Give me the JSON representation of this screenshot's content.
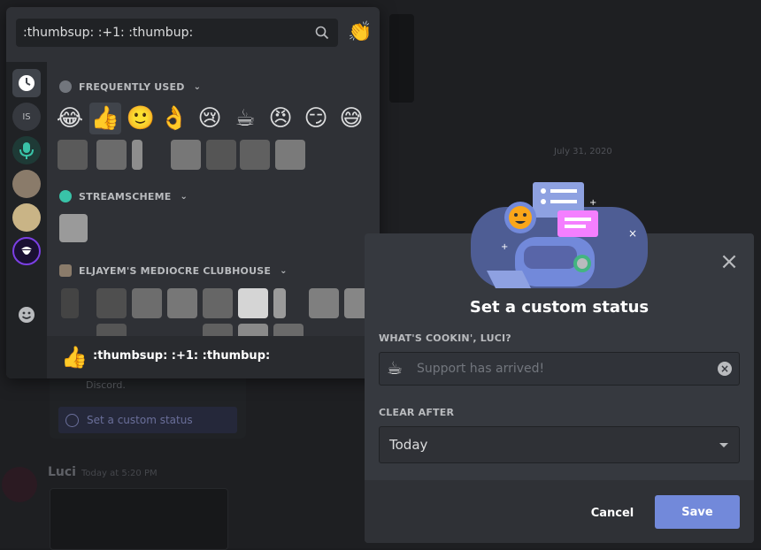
{
  "background": {
    "date_divider": "July 31, 2020",
    "card_text": "Discord.",
    "card_button": "Set a custom status",
    "username": "Luci",
    "timestamp": "Today at 5:20 PM"
  },
  "picker": {
    "search_value": ":thumbsup: :+1: :thumbup:",
    "header_emoji": "👏",
    "rail_items": [
      {
        "name": "frequently-used-icon",
        "glyph": "🕒"
      },
      {
        "name": "server-is",
        "glyph": "IS"
      },
      {
        "name": "server-streamscheme",
        "glyph": "🎙"
      },
      {
        "name": "server-1",
        "glyph": ""
      },
      {
        "name": "server-2",
        "glyph": ""
      },
      {
        "name": "server-3",
        "glyph": ""
      },
      {
        "name": "people-category-icon",
        "glyph": "☺"
      },
      {
        "name": "nature-category-icon",
        "glyph": "🍃"
      },
      {
        "name": "food-category-icon",
        "glyph": "🍦"
      }
    ],
    "categories": [
      {
        "label": "FREQUENTLY USED"
      },
      {
        "label": "STREAMSCHEME"
      },
      {
        "label": "ELJAYEM'S MEDIOCRE CLUBHOUSE"
      }
    ],
    "frequent_emojis": [
      "😂",
      "👍",
      "🙂",
      "👌",
      "😢",
      "☕",
      "😠",
      "😏",
      "😅"
    ],
    "footer_emoji": "👍",
    "footer_label": ":thumbsup: :+1: :thumbup:"
  },
  "modal": {
    "title": "Set a custom status",
    "status_label": "WHAT'S COOKIN', LUCI?",
    "status_emoji": "☕",
    "status_placeholder": "Support has arrived!",
    "clear_label": "CLEAR AFTER",
    "clear_value": "Today",
    "cancel_label": "Cancel",
    "save_label": "Save",
    "close_glyph": "×"
  },
  "colors": {
    "accent": "#7289da",
    "modal_bg": "#36393f",
    "picker_bg": "#2f3136"
  }
}
